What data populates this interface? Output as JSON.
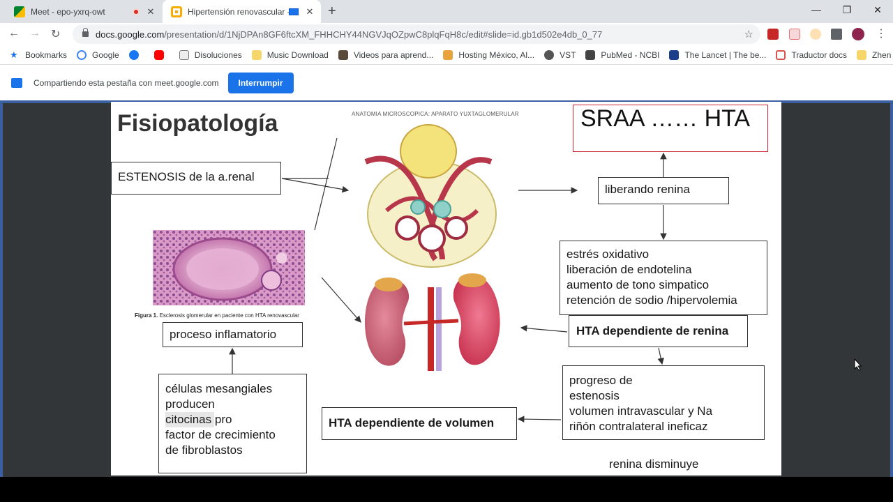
{
  "browser": {
    "tabs": [
      {
        "title": "Meet - epo-yxrq-owt",
        "favicon": "meet-icon",
        "recording": true
      },
      {
        "title": "Hipertensión renovascular -",
        "favicon": "slides-icon",
        "active": true,
        "casting": true
      }
    ],
    "url_domain": "docs.google.com",
    "url_path": "/presentation/d/1NjDPAn8GF6ftcXM_FHHCHY44NGVJqOZpwC8plqFqH8c/edit#slide=id.gb1d502e4db_0_77"
  },
  "bookmarks": [
    {
      "label": "Bookmarks",
      "icon": "star-icon"
    },
    {
      "label": "Google",
      "icon": "google-icon"
    },
    {
      "label": "",
      "icon": "facebook-icon"
    },
    {
      "label": "",
      "icon": "youtube-icon"
    },
    {
      "label": "Disoluciones",
      "icon": "flask-icon"
    },
    {
      "label": "Music Download",
      "icon": "folder-icon"
    },
    {
      "label": "Videos para aprend...",
      "icon": "video-icon"
    },
    {
      "label": "Hosting México, Al...",
      "icon": "hosting-icon"
    },
    {
      "label": "VST",
      "icon": "globe-icon"
    },
    {
      "label": "PubMed - NCBI",
      "icon": "pubmed-icon"
    },
    {
      "label": "The Lancet | The be...",
      "icon": "lancet-icon"
    },
    {
      "label": "Traductor docs",
      "icon": "translate-icon"
    },
    {
      "label": "Zhen",
      "icon": "folder-icon"
    }
  ],
  "sharebar": {
    "text": "Compartiendo esta pestaña con meet.google.com",
    "button": "Interrumpir"
  },
  "slide": {
    "title": "Fisiopatología",
    "headline": "SRAA …… HTA",
    "estenosis": "ESTENOSIS  de la a.renal",
    "liberando": "liberando renina",
    "micro_title": "ANATOMIA MICROSCOPICA: APARATO YUXTAGLOMERULAR",
    "effects": [
      "estrés oxidativo",
      "liberación de endotelina",
      "aumento de tono simpatico",
      "retención de sodio /hipervolemia"
    ],
    "hta_renina": "HTA dependiente de renina",
    "progreso": [
      "progreso de",
      "estenosis",
      "volumen intravascular y Na",
      "riñón contralateral ineficaz"
    ],
    "hta_volumen": "HTA dependiente de volumen",
    "renina_dism": "renina disminuye",
    "inflamatorio": "proceso inflamatorio",
    "celulas": [
      "células mesangiales",
      "producen",
      "citocinas pro",
      "factor de crecimiento",
      "de fibroblastos"
    ],
    "figura_label": "Figura 1.",
    "figura_text": "Esclerosis glomerular en paciente con HTA renovascular"
  }
}
